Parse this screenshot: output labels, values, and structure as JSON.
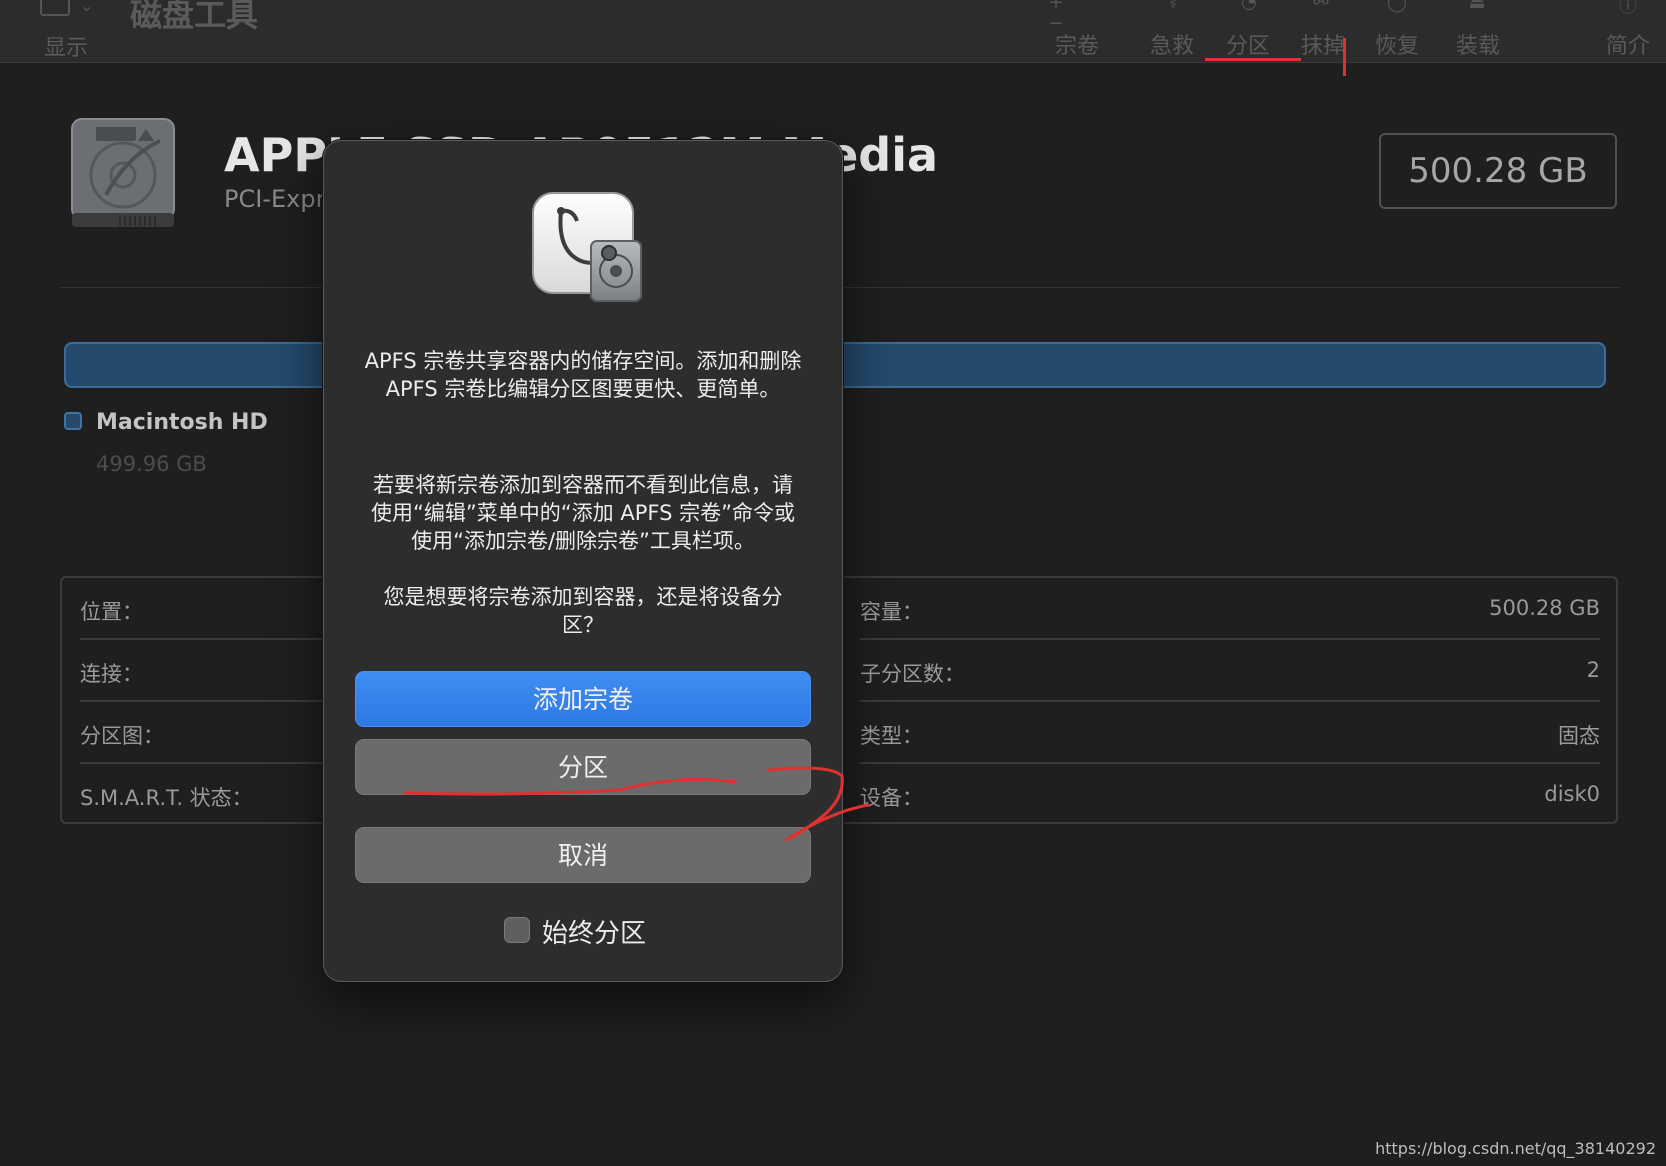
{
  "toolbar": {
    "view_label": "显示",
    "title": "磁盘工具",
    "items": [
      {
        "label": "宗卷",
        "icon": "plus-minus-icon"
      },
      {
        "label": "急救",
        "icon": "stethoscope-icon"
      },
      {
        "label": "分区",
        "icon": "partition-icon"
      },
      {
        "label": "抹掉",
        "icon": "erase-icon"
      },
      {
        "label": "恢复",
        "icon": "restore-icon"
      },
      {
        "label": "装载",
        "icon": "mount-icon"
      },
      {
        "label": "简介",
        "icon": "info-icon"
      }
    ]
  },
  "disk": {
    "name": "APPLE SSD AP0512M Media",
    "subtitle": "PCI-Express",
    "capacity": "500.28 GB"
  },
  "volume": {
    "name": "Macintosh HD",
    "size": "499.96 GB",
    "color": "#3f74a6"
  },
  "info": {
    "left": [
      {
        "label": "位置："
      },
      {
        "label": "连接："
      },
      {
        "label": "分区图："
      },
      {
        "label": "S.M.A.R.T. 状态："
      }
    ],
    "right": [
      {
        "label": "容量：",
        "value": "500.28 GB"
      },
      {
        "label": "子分区数：",
        "value": "2"
      },
      {
        "label": "类型：",
        "value": "固态"
      },
      {
        "label": "设备：",
        "value": "disk0"
      }
    ]
  },
  "dialog": {
    "icon": "disk-utility-app-icon",
    "message1": "APFS 宗卷共享容器内的储存空间。添加和删除 APFS 宗卷比编辑分区图要更快、更简单。",
    "message2": "若要将新宗卷添加到容器而不看到此信息，请使用“编辑”菜单中的“添加 APFS 宗卷”命令或使用“添加宗卷/删除宗卷”工具栏项。",
    "message3": "您是想要将宗卷添加到容器，还是将设备分区？",
    "add_volume_button": "添加宗卷",
    "partition_button": "分区",
    "cancel_button": "取消",
    "always_partition_label": "始终分区",
    "always_partition_checked": false
  },
  "watermark": "https://blog.csdn.net/qq_38140292",
  "colors": {
    "accent_blue": "#2f78e3",
    "annotation_red": "#e03030",
    "background": "#1f1f1f"
  }
}
